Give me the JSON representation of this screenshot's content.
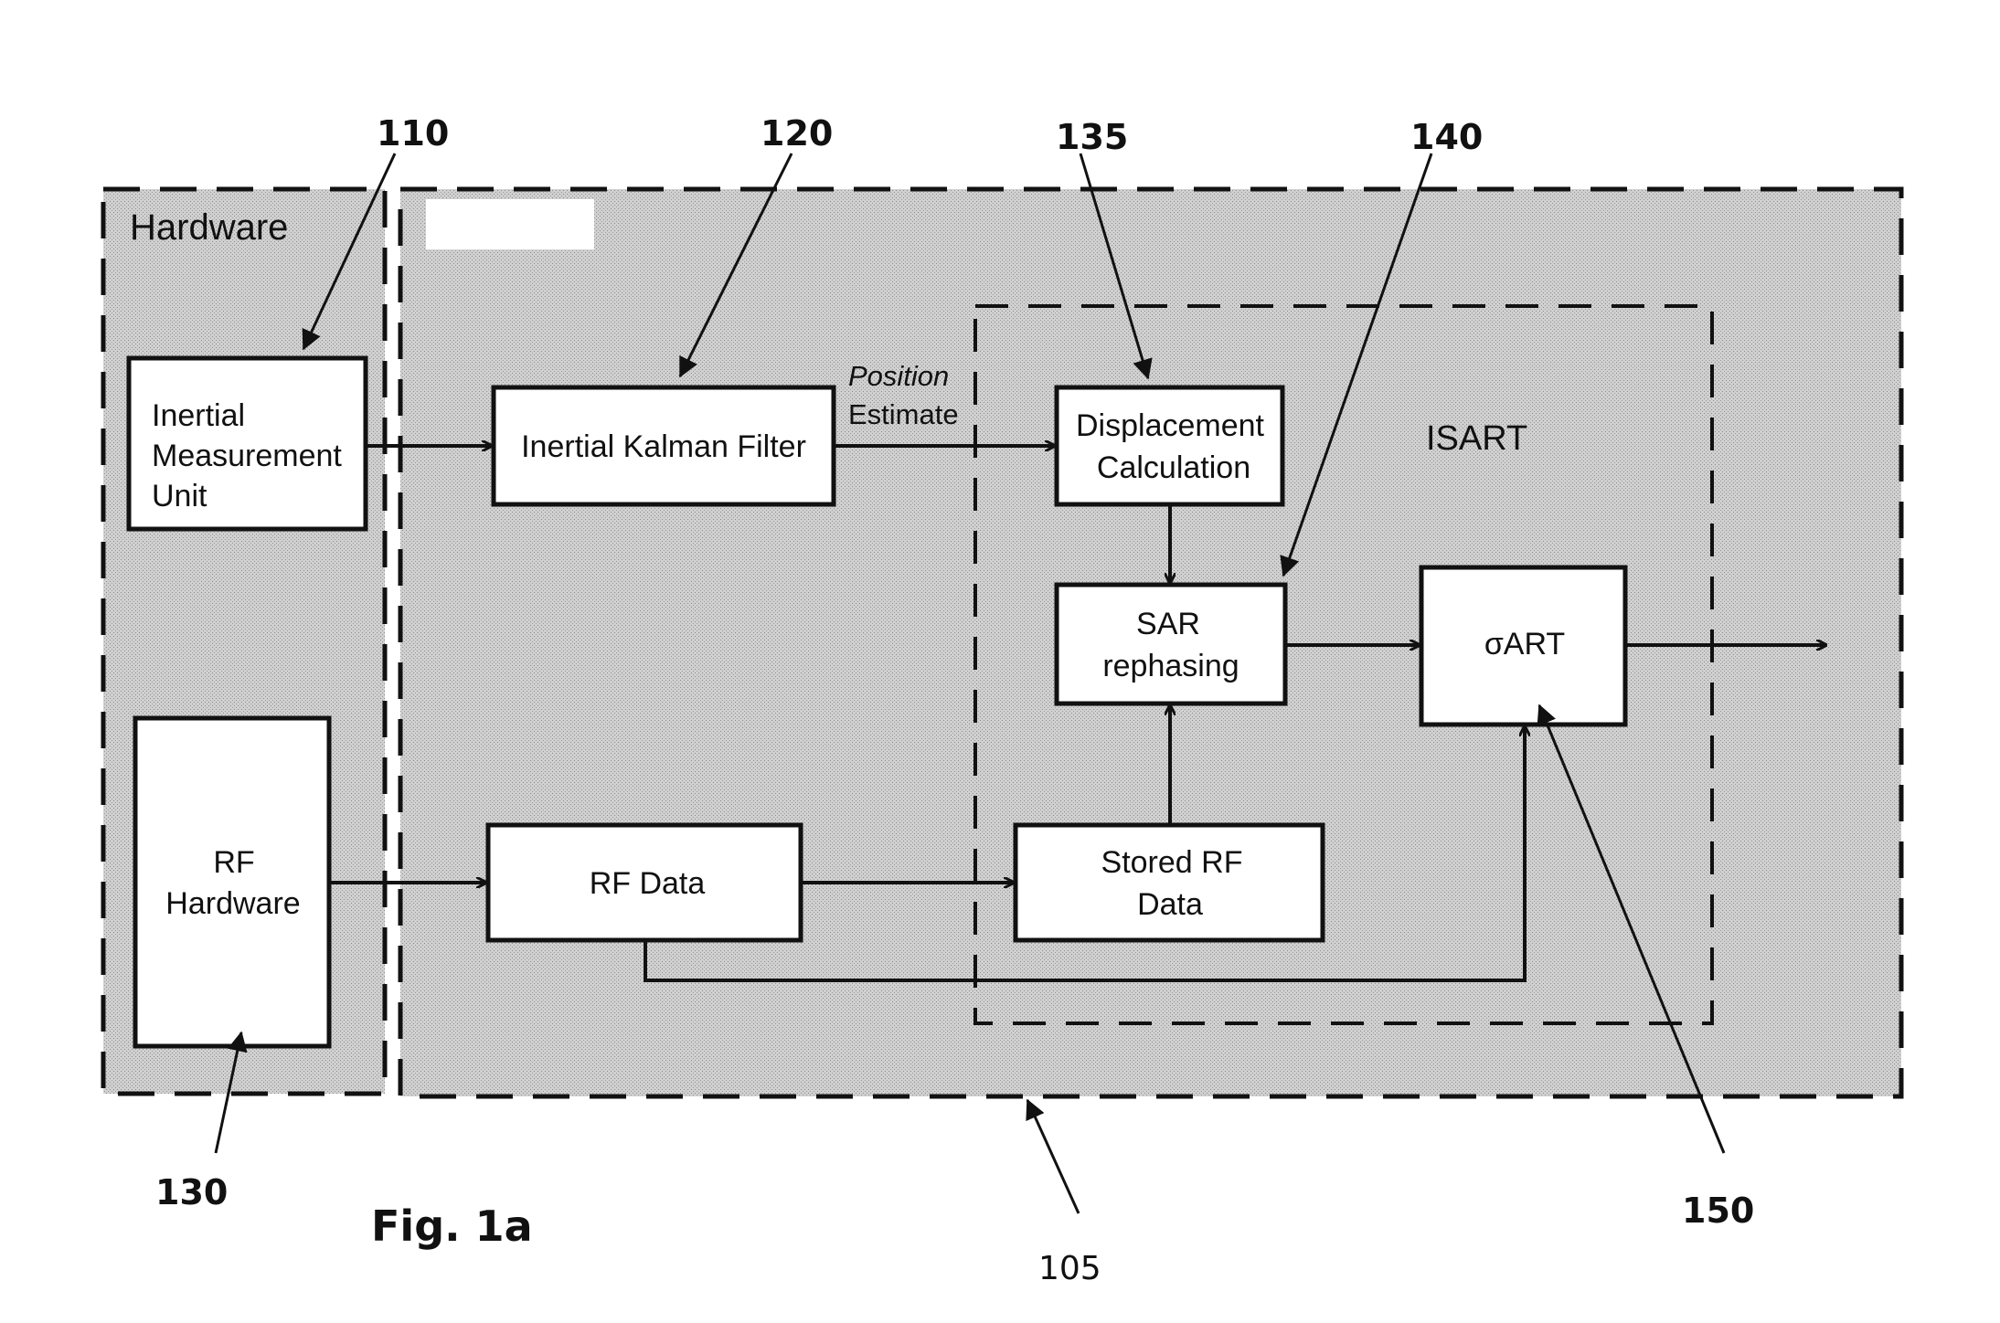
{
  "figure": {
    "caption": "Fig. 1a",
    "reference_numerals": {
      "imu": "110",
      "kalman": "120",
      "displacement": "135",
      "sar": "140",
      "rf_hardware": "130",
      "system": "105",
      "sart": "150"
    },
    "regions": {
      "hardware": "Hardware",
      "isart": "ISART"
    },
    "blocks": {
      "imu": [
        "Inertial",
        "Measurement",
        "Unit"
      ],
      "kalman": "Inertial Kalman Filter",
      "displacement": [
        "Displacement",
        "Calculation"
      ],
      "sar": [
        "SAR",
        "rephasing"
      ],
      "sart": "σART",
      "rf_hardware": [
        "RF",
        "Hardware"
      ],
      "rf_data": "RF Data",
      "stored_rf": [
        "Stored RF",
        "Data"
      ]
    },
    "edge_labels": {
      "position_estimate": [
        "Position",
        "Estimate"
      ]
    },
    "colors": {
      "region_fill": "#c8c8c8",
      "line": "#111111",
      "block_fill": "#ffffff"
    }
  }
}
